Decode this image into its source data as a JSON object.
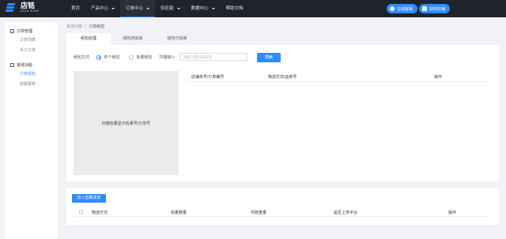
{
  "brand": {
    "name": "店铭",
    "subtitle": "DIAN MING",
    "color": "#2f8cff"
  },
  "topnav": [
    {
      "label": "首页",
      "caret": false
    },
    {
      "label": "产品中心",
      "caret": true
    },
    {
      "label": "订单中心",
      "caret": true
    },
    {
      "label": "供应链",
      "caret": true
    },
    {
      "label": "数据中心",
      "caret": true
    },
    {
      "label": "帮助文档",
      "caret": false
    }
  ],
  "header_buttons": {
    "service": "在线客服",
    "auth": "授权店铺"
  },
  "sidebar": {
    "groups": [
      {
        "title": "订单管理",
        "items": [
          "订单列表",
          "手工订单"
        ]
      },
      {
        "title": "其他功能",
        "items": [
          "订单组包",
          "数据报表"
        ]
      }
    ],
    "active_item": "订单组包"
  },
  "breadcrumb": {
    "parent": "其他功能",
    "separator": "/",
    "current": "订单组包"
  },
  "tabs": [
    "组包处理",
    "组包待出库",
    "组包已出库"
  ],
  "packing": {
    "method_label": "组包方式:",
    "single": "单个组包",
    "batch": "批量组包",
    "scan_label": "扫描输入:",
    "scan_placeholder": "请输入或扫描内容",
    "search_button": "搜索",
    "scan_area_text": "扫描包裹显示包裹号/订单号"
  },
  "table1_headers": [
    "店铺单号/订单编号",
    "物流方式/运单号",
    "操作"
  ],
  "join_button": "加入包裹清单",
  "table2_headers": [
    "物流方式",
    "包裹数量",
    "件数重量",
    "是否上传平台",
    "操作"
  ]
}
